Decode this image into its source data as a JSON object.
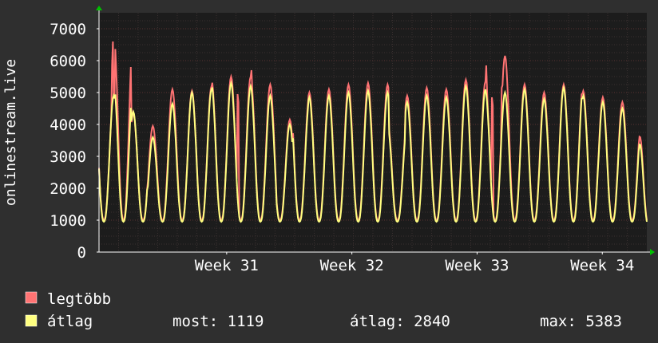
{
  "chart_data": {
    "type": "line",
    "ylabel": "onlinestream.live",
    "ylim": [
      0,
      7500
    ],
    "y_ticks": [
      0,
      1000,
      2000,
      3000,
      4000,
      5000,
      6000,
      7000
    ],
    "y_tick_labels": [
      "0",
      "1000",
      "2000",
      "3000",
      "4000",
      "5000",
      "6000",
      "7000"
    ],
    "x_range_days": [
      0,
      28
    ],
    "x_ticks": [
      {
        "label": "Week 31",
        "day": 5.3
      },
      {
        "label": "Week 32",
        "day": 11.7
      },
      {
        "label": "Week 33",
        "day": 18.1
      },
      {
        "label": "Week 34",
        "day": 24.5
      }
    ],
    "grid": true,
    "colors": {
      "background": "#2f2f2f",
      "plot_background": "#1c1c1c",
      "legtobb": "#ff7373",
      "atlag": "#ffff80",
      "grid": "#5a3232",
      "arrow": "#00c000"
    },
    "series": [
      {
        "name": "legtöbb",
        "color": "#ff7373",
        "values": [
          4900,
          6850,
          4350,
          3950,
          5100,
          5050,
          5200,
          5400,
          5500,
          5500,
          5250,
          4150,
          4900,
          5000,
          5100,
          5250,
          5300,
          5250,
          4100,
          4900,
          5150,
          5100,
          5400,
          5350,
          5300,
          6150,
          5250,
          5000,
          5250,
          5300,
          5050,
          4850,
          4700,
          4400
        ],
        "spikes": [
          {
            "day": 0.7,
            "value": 6850
          },
          {
            "day": 7.1,
            "value": 5450
          },
          {
            "day": 7.8,
            "value": 5950
          },
          {
            "day": 20.1,
            "value": 5350
          },
          {
            "day": 19.8,
            "value": 6100
          },
          {
            "day": 20.6,
            "value": 5650
          }
        ]
      },
      {
        "name": "átlag",
        "color": "#ffff80",
        "values": [
          4900,
          5300,
          4400,
          3600,
          4650,
          5000,
          5100,
          5250,
          5300,
          5200,
          4900,
          4000,
          4700,
          4850,
          4900,
          5000,
          5050,
          5000,
          3950,
          4700,
          4900,
          4850,
          5200,
          5100,
          5050,
          5000,
          5100,
          4800,
          5150,
          5150,
          4900,
          4700,
          4500,
          4100
        ]
      }
    ]
  },
  "legend": [
    {
      "name": "legtöbb",
      "color": "#ff7373"
    },
    {
      "name": "átlag",
      "color": "#ffff80"
    }
  ],
  "stats": {
    "most": "most: 1119",
    "atlag": "átlag: 2840",
    "max": "max: 5383"
  }
}
